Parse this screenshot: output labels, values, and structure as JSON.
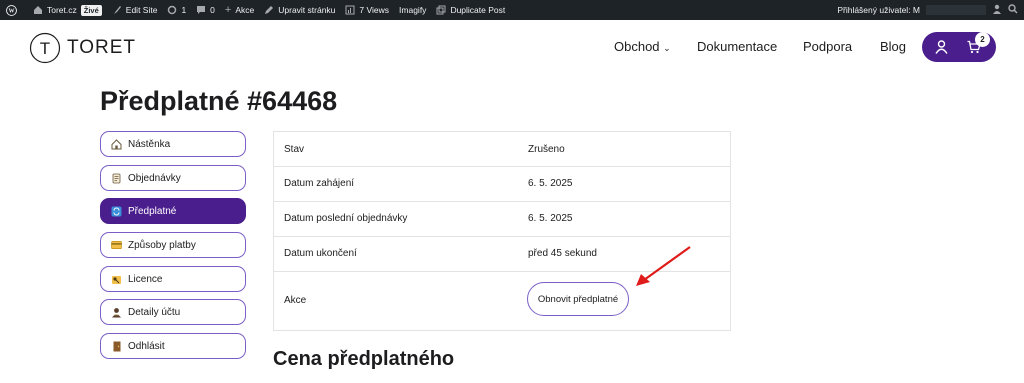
{
  "adminbar": {
    "site_name": "Toret.cz",
    "live_badge": "Živé",
    "edit_site": "Edit Site",
    "updates_count": "1",
    "comments_count": "0",
    "new_label": "Akce",
    "edit_page": "Upravit stránku",
    "views": "7 Views",
    "imagify": "Imagify",
    "duplicate_post": "Duplicate Post",
    "logged_in": "Přihlášený uživatel: M"
  },
  "header": {
    "logo_letter": "T",
    "logo_text": "TORET",
    "nav": [
      "Obchod",
      "Dokumentace",
      "Podpora",
      "Blog"
    ],
    "cart_count": "2",
    "accent_color": "#4b1e8e"
  },
  "page": {
    "title": "Předplatné #64468",
    "section_title": "Cena předplatného"
  },
  "sidebar": {
    "items": [
      {
        "label": "Nástěnka",
        "icon": "house-icon"
      },
      {
        "label": "Objednávky",
        "icon": "scroll-icon"
      },
      {
        "label": "Předplatné",
        "icon": "repeat-icon",
        "active": true
      },
      {
        "label": "Způsoby platby",
        "icon": "credit-card-icon"
      },
      {
        "label": "Licence",
        "icon": "key-icon"
      },
      {
        "label": "Detaily účtu",
        "icon": "user-icon"
      },
      {
        "label": "Odhlásit",
        "icon": "door-icon"
      }
    ]
  },
  "details": {
    "rows": [
      {
        "label": "Stav",
        "value": "Zrušeno"
      },
      {
        "label": "Datum zahájení",
        "value": "6. 5. 2025"
      },
      {
        "label": "Datum poslední objednávky",
        "value": "6. 5. 2025"
      },
      {
        "label": "Datum ukončení",
        "value": "před 45 sekund"
      },
      {
        "label": "Akce",
        "value": ""
      }
    ],
    "renew_button": "Obnovit předplatné"
  }
}
